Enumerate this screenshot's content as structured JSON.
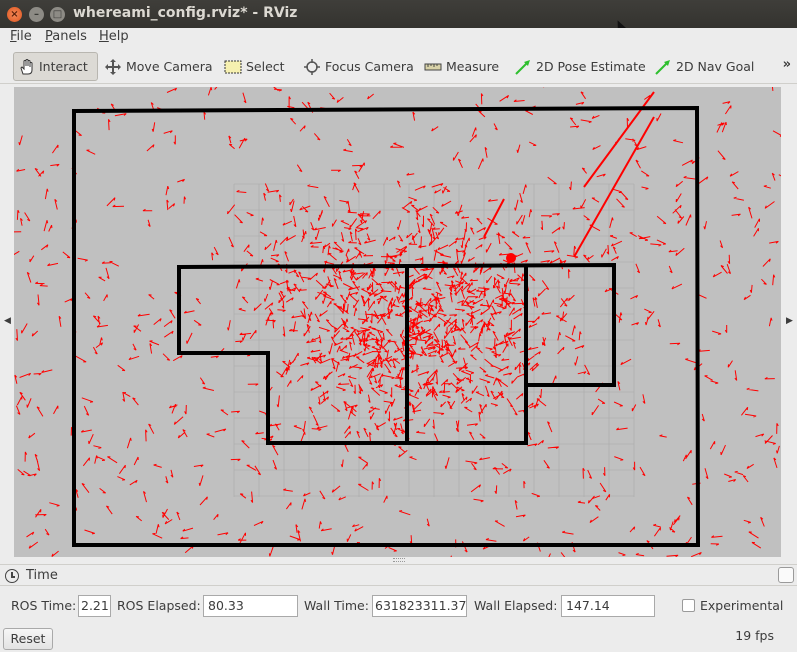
{
  "window": {
    "title": "whereami_config.rviz* - RViz"
  },
  "menu": [
    {
      "label": "File",
      "underline": "F",
      "rest": "ile"
    },
    {
      "label": "Panels",
      "underline": "P",
      "rest": "anels"
    },
    {
      "label": "Help",
      "underline": "H",
      "rest": "elp"
    }
  ],
  "toolbar": {
    "tools": [
      {
        "label": "Interact",
        "icon": "hand-icon",
        "active": true
      },
      {
        "label": "Move Camera",
        "icon": "move-camera-icon",
        "active": false
      },
      {
        "label": "Select",
        "icon": "select-icon",
        "active": false
      },
      {
        "label": "Focus Camera",
        "icon": "focus-camera-icon",
        "active": false
      },
      {
        "label": "Measure",
        "icon": "ruler-icon",
        "active": false
      },
      {
        "label": "2D Pose Estimate",
        "icon": "green-arrow-icon",
        "active": false
      },
      {
        "label": "2D Nav Goal",
        "icon": "green-arrow-icon",
        "active": false
      }
    ],
    "more": "»"
  },
  "colors": {
    "viewport_bg": "#c0c0c0",
    "particles": "#ff0000",
    "walls": "#000000",
    "grid": "#a8a8a8"
  },
  "time_panel": {
    "title": "Time",
    "ros_time_label": "ROS Time:",
    "ros_time_value": "2.21",
    "ros_elapsed_label": "ROS Elapsed:",
    "ros_elapsed_value": "80.33",
    "wall_time_label": "Wall Time:",
    "wall_time_value": "631823311.37",
    "wall_elapsed_label": "Wall Elapsed:",
    "wall_elapsed_value": "147.14",
    "experimental_label": "Experimental",
    "experimental_checked": false,
    "reset_label": "Reset",
    "fps": "19 fps"
  }
}
